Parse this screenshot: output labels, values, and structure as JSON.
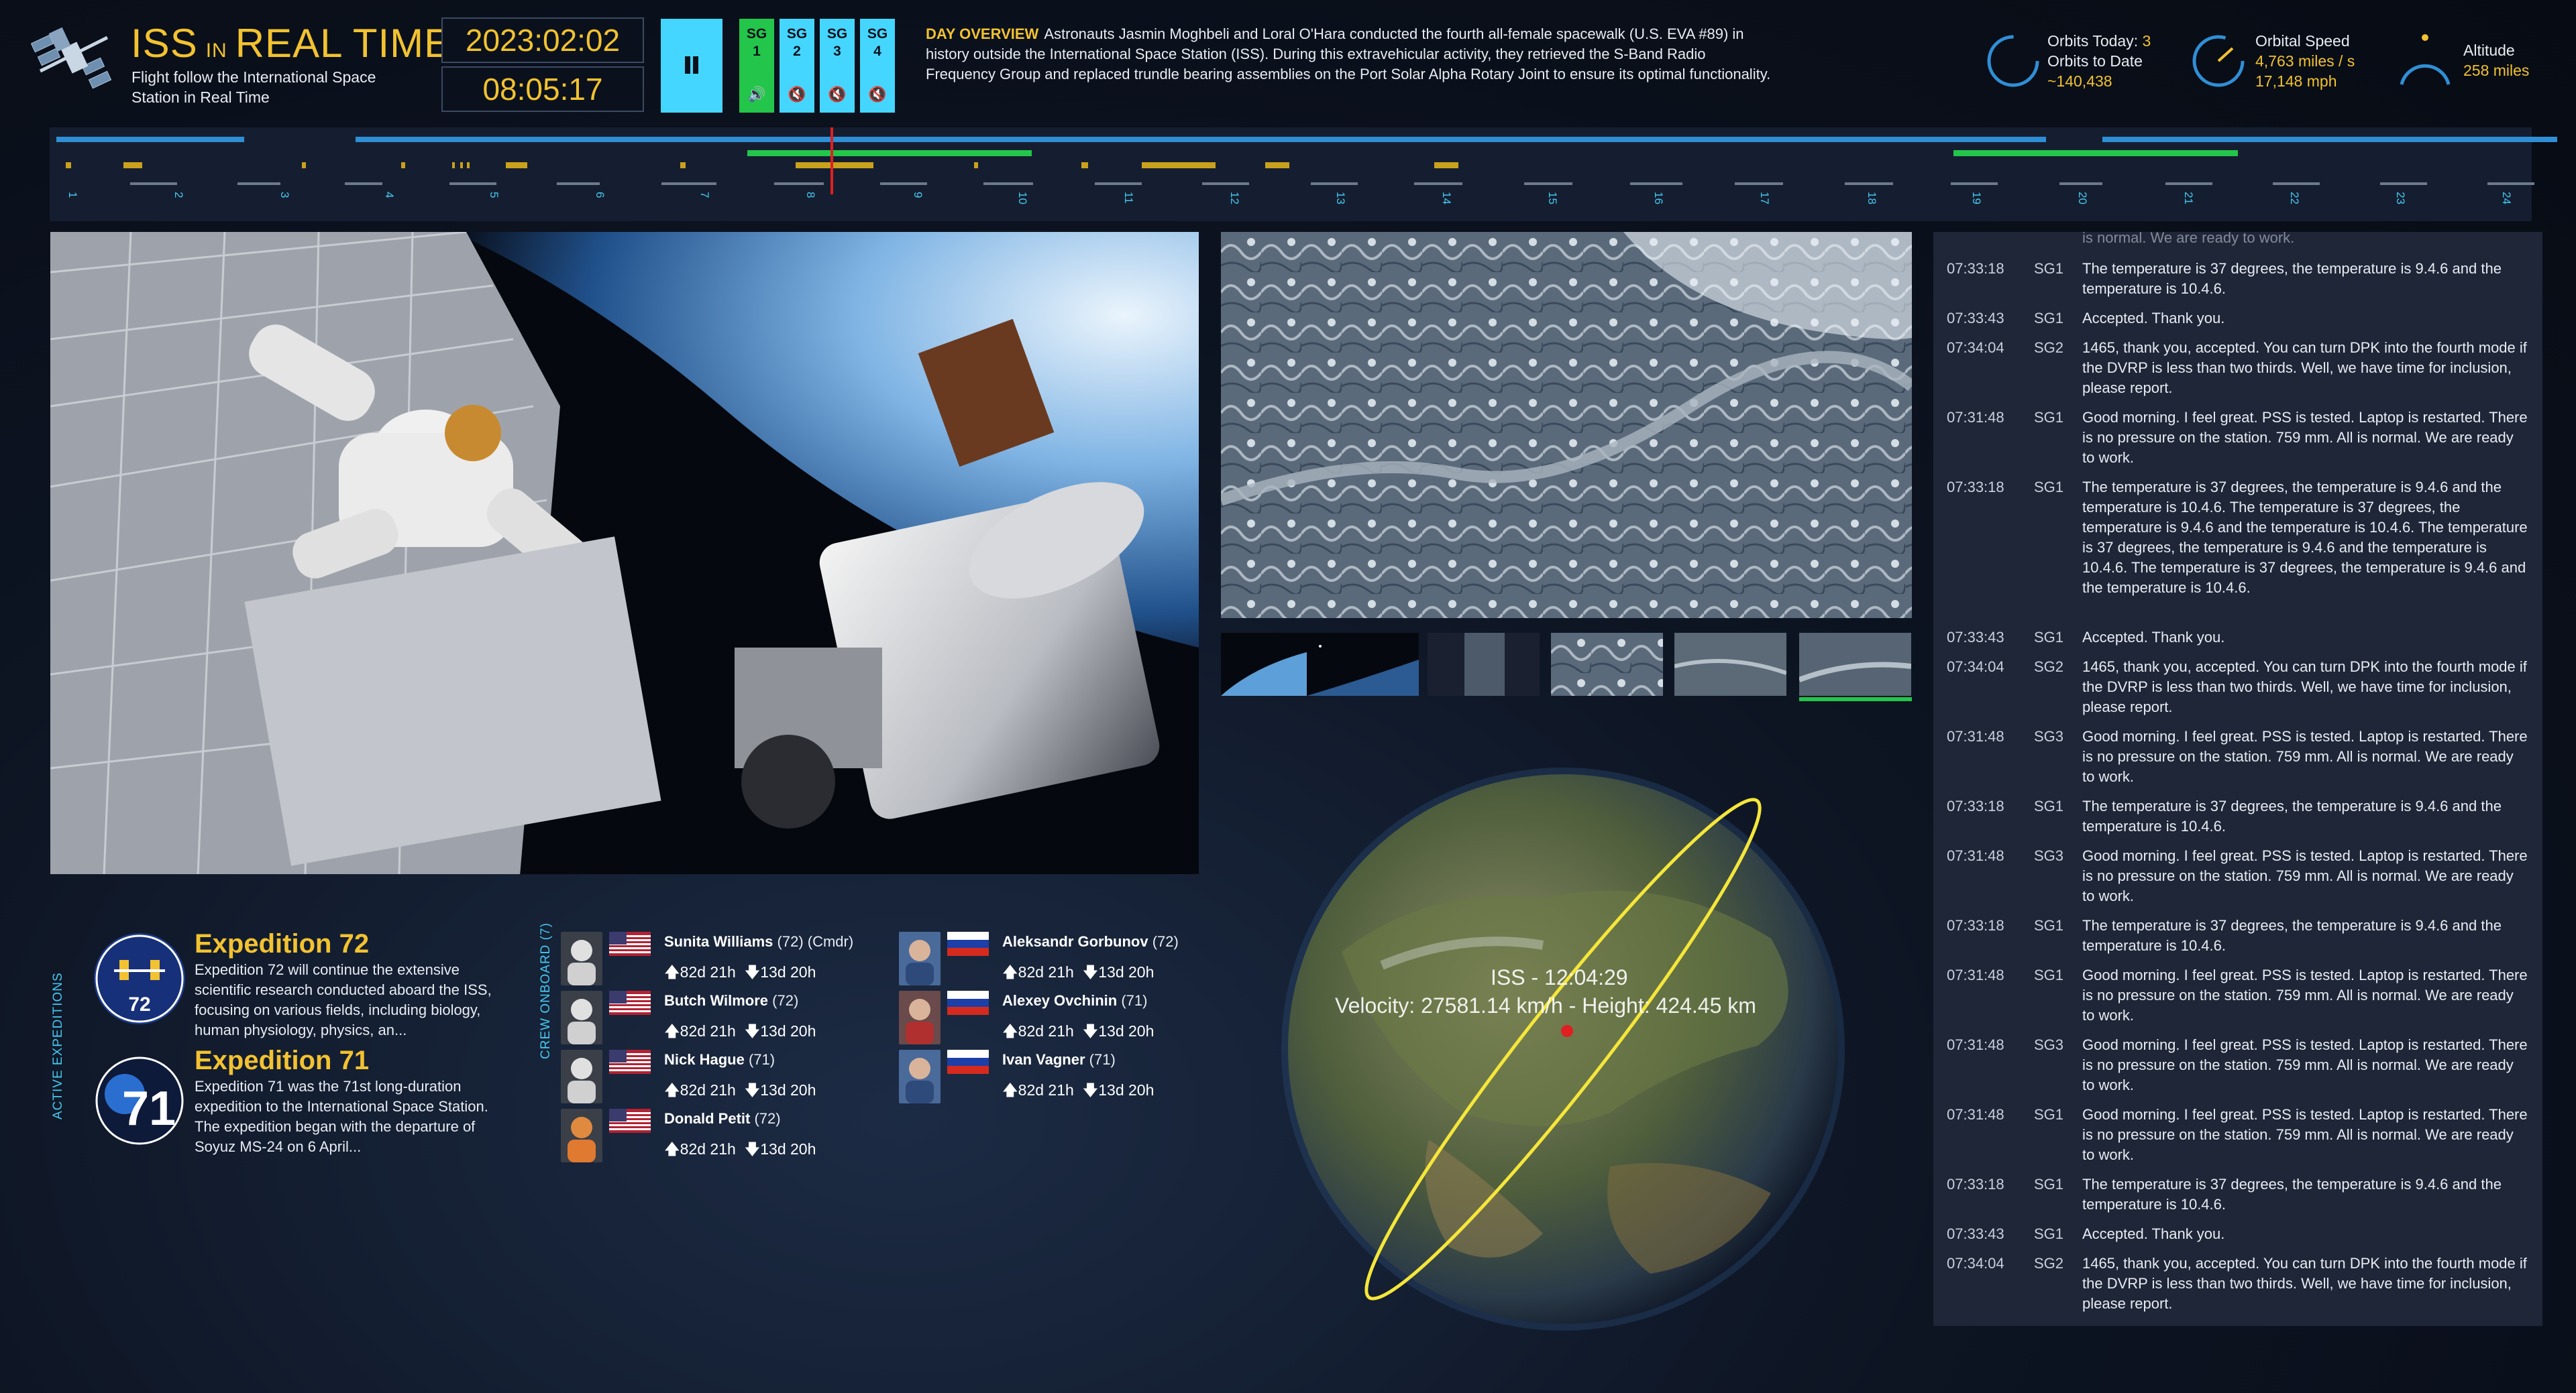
{
  "header": {
    "title_iss": "ISS",
    "title_in": "IN",
    "title_realtime": "REAL TIME",
    "subtitle": "Flight follow the International Space Station in Real Time"
  },
  "clock": {
    "date": "2023:02:02",
    "time": "08:05:17"
  },
  "controls": {
    "pause_icon": "pause-icon",
    "sg_buttons": [
      {
        "label_top": "SG",
        "label_num": "1",
        "icon": "volume-on-icon",
        "active": true
      },
      {
        "label_top": "SG",
        "label_num": "2",
        "icon": "volume-muted-icon",
        "active": false
      },
      {
        "label_top": "SG",
        "label_num": "3",
        "icon": "volume-muted-icon",
        "active": false
      },
      {
        "label_top": "SG",
        "label_num": "4",
        "icon": "volume-muted-icon",
        "active": false
      }
    ]
  },
  "overview": {
    "heading": "DAY OVERVIEW",
    "text": "Astronauts Jasmin Moghbeli and Loral O'Hara conducted the fourth all-female spacewalk (U.S. EVA #89) in history outside the International Space Station (ISS). During this extravehicular activity, they retrieved the S-Band Radio Frequency Group and replaced trundle bearing assemblies on the Port Solar Alpha Rotary Joint to ensure its optimal functionality."
  },
  "stats": {
    "orbits_today_label": "Orbits Today:",
    "orbits_today_value": "3",
    "orbits_to_date_label": "Orbits to Date",
    "orbits_to_date_value": "~140,438",
    "orbital_speed_label": "Orbital Speed",
    "orbital_speed_value_1": "4,763 miles / s",
    "orbital_speed_value_2": "17,148 mph",
    "altitude_label": "Altitude",
    "altitude_value": "258 miles"
  },
  "timeline": {
    "hours": [
      "1",
      "2",
      "3",
      "4",
      "5",
      "6",
      "7",
      "8",
      "9",
      "10",
      "11",
      "12",
      "13",
      "14",
      "15",
      "16",
      "17",
      "18",
      "19",
      "20",
      "21",
      "22",
      "23",
      "24"
    ]
  },
  "log": [
    {
      "time": "",
      "src": "",
      "msg": "is normal. We are ready to work."
    },
    {
      "time": "07:33:18",
      "src": "SG1",
      "msg": "The temperature is 37 degrees, the temperature is 9.4.6 and the temperature is 10.4.6."
    },
    {
      "time": "07:33:43",
      "src": "SG1",
      "msg": "Accepted. Thank you."
    },
    {
      "time": "07:34:04",
      "src": "SG2",
      "msg": "1465, thank you, accepted. You can turn DPK into the fourth mode if the DVRP is less than two thirds. Well, we have time for inclusion, please report."
    },
    {
      "time": "07:31:48",
      "src": "SG1",
      "msg": "Good morning. I feel great. PSS is tested. Laptop is restarted. There is no pressure on the station. 759 mm. All is normal. We are ready to work."
    },
    {
      "time": "07:33:18",
      "src": "SG1",
      "msg": "The temperature is 37 degrees, the temperature is 9.4.6 and the temperature is 10.4.6. The temperature is 37 degrees, the temperature is 9.4.6 and the temperature is 10.4.6. The temperature is 37 degrees, the temperature is 9.4.6 and the temperature is 10.4.6. The temperature is 37 degrees, the temperature is 9.4.6 and the temperature is 10.4.6."
    },
    {
      "time": "07:33:43",
      "src": "SG1",
      "msg": "Accepted. Thank you."
    },
    {
      "time": "07:34:04",
      "src": "SG2",
      "msg": "1465, thank you, accepted. You can turn DPK into the fourth mode if the DVRP is less than two thirds. Well, we have time for inclusion, please report."
    },
    {
      "time": "07:31:48",
      "src": "SG3",
      "msg": "Good morning. I feel great. PSS is tested. Laptop is restarted. There is no pressure on the station. 759 mm. All is normal. We are ready to work."
    },
    {
      "time": "07:33:18",
      "src": "SG1",
      "msg": "The temperature is 37 degrees, the temperature is 9.4.6 and the temperature is 10.4.6."
    },
    {
      "time": "07:31:48",
      "src": "SG3",
      "msg": "Good morning. I feel great. PSS is tested. Laptop is restarted. There is no pressure on the station. 759 mm. All is normal. We are ready to work."
    },
    {
      "time": "07:33:18",
      "src": "SG1",
      "msg": "The temperature is 37 degrees, the temperature is 9.4.6 and the temperature is 10.4.6."
    },
    {
      "time": "07:31:48",
      "src": "SG1",
      "msg": "Good morning. I feel great. PSS is tested. Laptop is restarted. There is no pressure on the station. 759 mm. All is normal. We are ready to work."
    },
    {
      "time": "07:31:48",
      "src": "SG3",
      "msg": "Good morning. I feel great. PSS is tested. Laptop is restarted. There is no pressure on the station. 759 mm. All is normal. We are ready to work."
    },
    {
      "time": "07:31:48",
      "src": "SG1",
      "msg": "Good morning. I feel great. PSS is tested. Laptop is restarted. There is no pressure on the station. 759 mm. All is normal. We are ready to work."
    },
    {
      "time": "07:33:18",
      "src": "SG1",
      "msg": "The temperature is 37 degrees, the temperature is 9.4.6 and the temperature is 10.4.6."
    },
    {
      "time": "07:33:43",
      "src": "SG1",
      "msg": "Accepted. Thank you."
    },
    {
      "time": "07:34:04",
      "src": "SG2",
      "msg": "1465, thank you, accepted. You can turn DPK into the fourth mode if the DVRP is less than two thirds. Well, we have time for inclusion, please report."
    }
  ],
  "expeditions": {
    "section_label": "ACTIVE EXPEDITIONS",
    "items": [
      {
        "title": "Expedition 72",
        "badge_text": "72",
        "desc": "Expedition 72 will continue the extensive scientific research conducted aboard the ISS, focusing on various fields, including biology, human physiology, physics, an..."
      },
      {
        "title": "Expedition 71",
        "badge_text": "71",
        "desc": "Expedition 71 was the 71st long-duration expedition to the International Space Station. The expedition began with the departure of Soyuz MS-24 on 6 April..."
      }
    ]
  },
  "crew": {
    "section_label": "CREW ONBOARD (7)",
    "members": [
      {
        "name": "Sunita Williams",
        "exp": "(72) (Cmdr)",
        "flag": "us",
        "up": "82d 21h",
        "down": "13d 20h"
      },
      {
        "name": "Butch Wilmore",
        "exp": "(72)",
        "flag": "us",
        "up": "82d 21h",
        "down": "13d 20h"
      },
      {
        "name": "Nick Hague",
        "exp": "(71)",
        "flag": "us",
        "up": "82d 21h",
        "down": "13d 20h"
      },
      {
        "name": "Donald Petit",
        "exp": "(72)",
        "flag": "us",
        "up": "82d 21h",
        "down": "13d 20h"
      },
      {
        "name": "Aleksandr Gorbunov",
        "exp": "(72)",
        "flag": "ru",
        "up": "82d 21h",
        "down": "13d 20h"
      },
      {
        "name": "Alexey Ovchinin",
        "exp": "(71)",
        "flag": "ru",
        "up": "82d 21h",
        "down": "13d 20h"
      },
      {
        "name": "Ivan Vagner",
        "exp": "(71)",
        "flag": "ru",
        "up": "82d 21h",
        "down": "13d 20h"
      }
    ]
  },
  "globe": {
    "iss_label": "ISS - 12:04:29",
    "velocity_label": "Velocity: 27581.14 km/h - Height: 424.45 km"
  },
  "colors": {
    "accent_yellow": "#f2c230",
    "accent_cyan": "#45d6ff",
    "active_green": "#23c64a",
    "timeline_blue": "#2f8fd6",
    "marker_red": "#e02020"
  }
}
